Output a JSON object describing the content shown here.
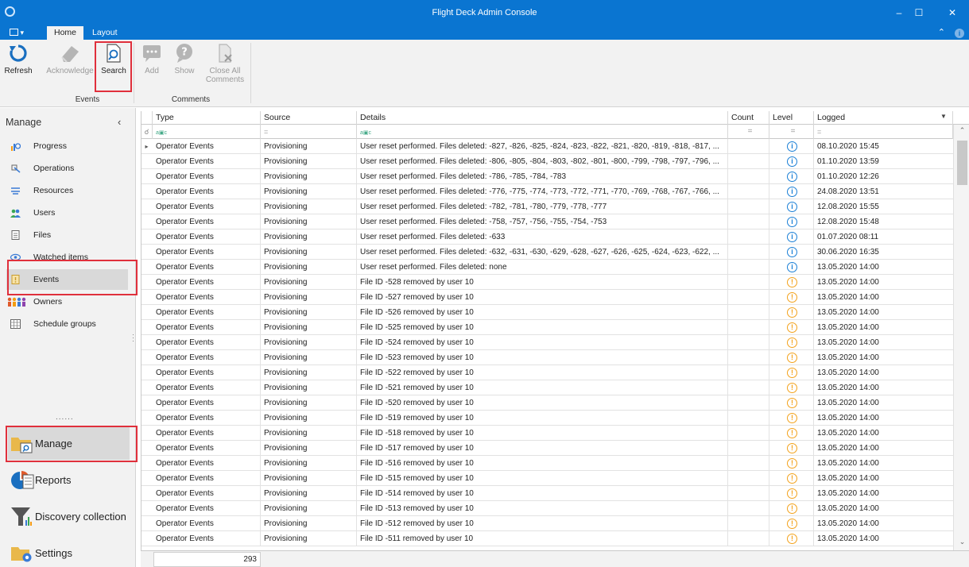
{
  "window": {
    "title": "Flight Deck Admin Console"
  },
  "tabs": [
    {
      "label": "Home"
    },
    {
      "label": "Layout"
    }
  ],
  "ribbon": {
    "refresh": "Refresh",
    "acknowledge": "Acknowledge",
    "search": "Search",
    "add": "Add",
    "show": "Show",
    "close_all_1": "Close All",
    "close_all_2": "Comments",
    "group_events": "Events",
    "group_comments": "Comments"
  },
  "sidebar": {
    "header": "Manage",
    "items": [
      {
        "label": "Progress",
        "icon": "progress-icon"
      },
      {
        "label": "Operations",
        "icon": "operations-icon"
      },
      {
        "label": "Resources",
        "icon": "resources-icon"
      },
      {
        "label": "Users",
        "icon": "users-icon"
      },
      {
        "label": "Files",
        "icon": "files-icon"
      },
      {
        "label": "Watched items",
        "icon": "eye-icon"
      },
      {
        "label": "Events",
        "icon": "events-icon"
      },
      {
        "label": "Owners",
        "icon": "owners-icon"
      },
      {
        "label": "Schedule groups",
        "icon": "schedule-icon"
      }
    ],
    "nav": [
      {
        "label": "Manage"
      },
      {
        "label": "Reports"
      },
      {
        "label": "Discovery collection"
      },
      {
        "label": "Settings"
      }
    ]
  },
  "grid": {
    "columns": [
      "Type",
      "Source",
      "Details",
      "Count",
      "Level",
      "Logged"
    ],
    "rows": [
      {
        "type": "Operator Events",
        "source": "Provisioning",
        "details": "User reset performed. Files deleted: -827, -826, -825, -824, -823, -822, -821, -820, -819, -818, -817, ...",
        "count": "",
        "level": "info",
        "logged": "08.10.2020 15:45"
      },
      {
        "type": "Operator Events",
        "source": "Provisioning",
        "details": "User reset performed. Files deleted: -806, -805, -804, -803, -802, -801, -800, -799, -798, -797, -796, ...",
        "count": "",
        "level": "info",
        "logged": "01.10.2020 13:59"
      },
      {
        "type": "Operator Events",
        "source": "Provisioning",
        "details": "User reset performed. Files deleted: -786, -785, -784, -783",
        "count": "",
        "level": "info",
        "logged": "01.10.2020 12:26"
      },
      {
        "type": "Operator Events",
        "source": "Provisioning",
        "details": "User reset performed. Files deleted: -776, -775, -774, -773, -772, -771, -770, -769, -768, -767, -766, ...",
        "count": "",
        "level": "info",
        "logged": "24.08.2020 13:51"
      },
      {
        "type": "Operator Events",
        "source": "Provisioning",
        "details": "User reset performed. Files deleted: -782, -781, -780, -779, -778, -777",
        "count": "",
        "level": "info",
        "logged": "12.08.2020 15:55"
      },
      {
        "type": "Operator Events",
        "source": "Provisioning",
        "details": "User reset performed. Files deleted: -758, -757, -756, -755, -754, -753",
        "count": "",
        "level": "info",
        "logged": "12.08.2020 15:48"
      },
      {
        "type": "Operator Events",
        "source": "Provisioning",
        "details": "User reset performed. Files deleted: -633",
        "count": "",
        "level": "info",
        "logged": "01.07.2020 08:11"
      },
      {
        "type": "Operator Events",
        "source": "Provisioning",
        "details": "User reset performed. Files deleted: -632, -631, -630, -629, -628, -627, -626, -625, -624, -623, -622, ...",
        "count": "",
        "level": "info",
        "logged": "30.06.2020 16:35"
      },
      {
        "type": "Operator Events",
        "source": "Provisioning",
        "details": "User reset performed. Files deleted: none",
        "count": "",
        "level": "info",
        "logged": "13.05.2020 14:00"
      },
      {
        "type": "Operator Events",
        "source": "Provisioning",
        "details": "File ID -528 removed by user 10",
        "count": "",
        "level": "warn",
        "logged": "13.05.2020 14:00"
      },
      {
        "type": "Operator Events",
        "source": "Provisioning",
        "details": "File ID -527 removed by user 10",
        "count": "",
        "level": "warn",
        "logged": "13.05.2020 14:00"
      },
      {
        "type": "Operator Events",
        "source": "Provisioning",
        "details": "File ID -526 removed by user 10",
        "count": "",
        "level": "warn",
        "logged": "13.05.2020 14:00"
      },
      {
        "type": "Operator Events",
        "source": "Provisioning",
        "details": "File ID -525 removed by user 10",
        "count": "",
        "level": "warn",
        "logged": "13.05.2020 14:00"
      },
      {
        "type": "Operator Events",
        "source": "Provisioning",
        "details": "File ID -524 removed by user 10",
        "count": "",
        "level": "warn",
        "logged": "13.05.2020 14:00"
      },
      {
        "type": "Operator Events",
        "source": "Provisioning",
        "details": "File ID -523 removed by user 10",
        "count": "",
        "level": "warn",
        "logged": "13.05.2020 14:00"
      },
      {
        "type": "Operator Events",
        "source": "Provisioning",
        "details": "File ID -522 removed by user 10",
        "count": "",
        "level": "warn",
        "logged": "13.05.2020 14:00"
      },
      {
        "type": "Operator Events",
        "source": "Provisioning",
        "details": "File ID -521 removed by user 10",
        "count": "",
        "level": "warn",
        "logged": "13.05.2020 14:00"
      },
      {
        "type": "Operator Events",
        "source": "Provisioning",
        "details": "File ID -520 removed by user 10",
        "count": "",
        "level": "warn",
        "logged": "13.05.2020 14:00"
      },
      {
        "type": "Operator Events",
        "source": "Provisioning",
        "details": "File ID -519 removed by user 10",
        "count": "",
        "level": "warn",
        "logged": "13.05.2020 14:00"
      },
      {
        "type": "Operator Events",
        "source": "Provisioning",
        "details": "File ID -518 removed by user 10",
        "count": "",
        "level": "warn",
        "logged": "13.05.2020 14:00"
      },
      {
        "type": "Operator Events",
        "source": "Provisioning",
        "details": "File ID -517 removed by user 10",
        "count": "",
        "level": "warn",
        "logged": "13.05.2020 14:00"
      },
      {
        "type": "Operator Events",
        "source": "Provisioning",
        "details": "File ID -516 removed by user 10",
        "count": "",
        "level": "warn",
        "logged": "13.05.2020 14:00"
      },
      {
        "type": "Operator Events",
        "source": "Provisioning",
        "details": "File ID -515 removed by user 10",
        "count": "",
        "level": "warn",
        "logged": "13.05.2020 14:00"
      },
      {
        "type": "Operator Events",
        "source": "Provisioning",
        "details": "File ID -514 removed by user 10",
        "count": "",
        "level": "warn",
        "logged": "13.05.2020 14:00"
      },
      {
        "type": "Operator Events",
        "source": "Provisioning",
        "details": "File ID -513 removed by user 10",
        "count": "",
        "level": "warn",
        "logged": "13.05.2020 14:00"
      },
      {
        "type": "Operator Events",
        "source": "Provisioning",
        "details": "File ID -512 removed by user 10",
        "count": "",
        "level": "warn",
        "logged": "13.05.2020 14:00"
      },
      {
        "type": "Operator Events",
        "source": "Provisioning",
        "details": "File ID -511 removed by user 10",
        "count": "",
        "level": "warn",
        "logged": "13.05.2020 14:00"
      }
    ],
    "footer_count": "293"
  },
  "colors": {
    "accent": "#0a75d1",
    "info": "#1a7fd6",
    "warning": "#f3a21c",
    "highlight": "#e0303c"
  }
}
